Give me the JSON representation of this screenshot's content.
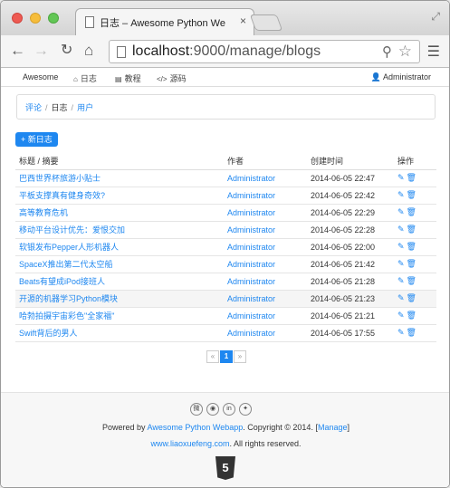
{
  "browser": {
    "tab_title": "日志 – Awesome Python We",
    "tab_close": "×",
    "url_host": "localhost",
    "url_rest": ":9000/manage/blogs"
  },
  "nav": {
    "brand": "Awesome",
    "items": [
      {
        "icon": "home-icon",
        "label": "日志"
      },
      {
        "icon": "book-icon",
        "label": "教程"
      },
      {
        "icon": "code-icon",
        "label": "源码"
      }
    ],
    "user": "Administrator"
  },
  "breadcrumb": [
    "评论",
    "日志",
    "用户"
  ],
  "new_button": "+ 新日志",
  "table": {
    "headers": [
      "标题 / 摘要",
      "作者",
      "创建时间",
      "操作"
    ],
    "rows": [
      {
        "title": "巴西世界杯旅游小贴士",
        "author": "Administrator",
        "date": "2014-06-05 22:47"
      },
      {
        "title": "平板支撑真有健身奇效?",
        "author": "Administrator",
        "date": "2014-06-05 22:42"
      },
      {
        "title": "高等教育危机",
        "author": "Administrator",
        "date": "2014-06-05 22:29"
      },
      {
        "title": "移动平台设计优先：爱恨交加",
        "author": "Administrator",
        "date": "2014-06-05 22:28"
      },
      {
        "title": "软银发布Pepper人形机器人",
        "author": "Administrator",
        "date": "2014-06-05 22:00"
      },
      {
        "title": "SpaceX推出第二代太空船",
        "author": "Administrator",
        "date": "2014-06-05 21:42"
      },
      {
        "title": "Beats有望成iPod接班人",
        "author": "Administrator",
        "date": "2014-06-05 21:28"
      },
      {
        "title": "开源的机器学习Python模块",
        "author": "Administrator",
        "date": "2014-06-05 21:23"
      },
      {
        "title": "哈勃拍摄宇宙彩色\"全家福\"",
        "author": "Administrator",
        "date": "2014-06-05 21:21"
      },
      {
        "title": "Swift背后的男人",
        "author": "Administrator",
        "date": "2014-06-05 17:55"
      }
    ]
  },
  "pager": {
    "prev": "«",
    "page": "1",
    "next": "»"
  },
  "footer": {
    "powered_prefix": "Powered by ",
    "powered_link": "Awesome Python Webapp",
    "copyright": ". Copyright © 2014. [",
    "manage_link": "Manage",
    "close_bracket": "]",
    "site_link": "www.liaoxuefeng.com",
    "rights": ". All rights reserved.",
    "html5_label": "5"
  },
  "colors": {
    "accent": "#1e87f0"
  }
}
